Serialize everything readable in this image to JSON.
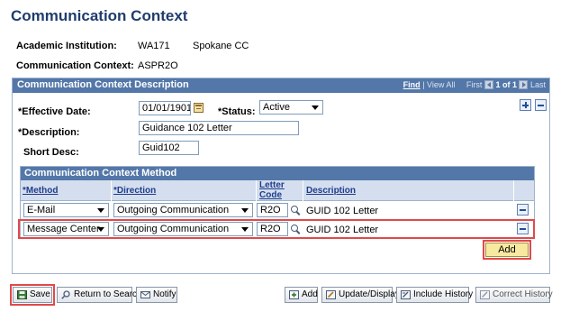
{
  "page": {
    "title": "Communication Context"
  },
  "info": {
    "institution_label": "Academic Institution:",
    "institution_code": "WA171",
    "institution_name": "Spokane CC",
    "context_label": "Communication Context:",
    "context_value": "ASPR2O"
  },
  "panel": {
    "title": "Communication Context Description",
    "find_link": "Find",
    "view_all_link": "View All",
    "first_label": "First",
    "count": "1 of 1",
    "last_label": "Last",
    "effective_date_label": "*Effective Date:",
    "effective_date": "01/01/1901",
    "status_label": "*Status:",
    "status": "Active",
    "description_label": "*Description:",
    "description": "Guidance 102 Letter",
    "short_desc_label": "Short Desc:",
    "short_desc": "Guid102"
  },
  "method_grid": {
    "title": "Communication Context Method",
    "col_method": "*Method",
    "col_direction": "*Direction",
    "col_letter_code_1": "Letter",
    "col_letter_code_2": "Code",
    "col_description": "Description",
    "rows": [
      {
        "method": "E-Mail",
        "direction": "Outgoing Communication",
        "letter_code": "R2O",
        "description": "GUID 102 Letter"
      },
      {
        "method": "Message Center",
        "direction": "Outgoing Communication",
        "letter_code": "R2O",
        "description": "GUID 102 Letter"
      }
    ],
    "add_label": "Add"
  },
  "toolbar": {
    "save": "Save",
    "return_to_search": "Return to Search",
    "notify": "Notify",
    "add": "Add",
    "update_display": "Update/Display",
    "include_history": "Include History",
    "correct_history": "Correct History"
  },
  "colors": {
    "title": "#1f3c6e",
    "header_bar": "#5377a8",
    "highlight": "#e04a4a",
    "add_button": "#f7e9a0"
  }
}
